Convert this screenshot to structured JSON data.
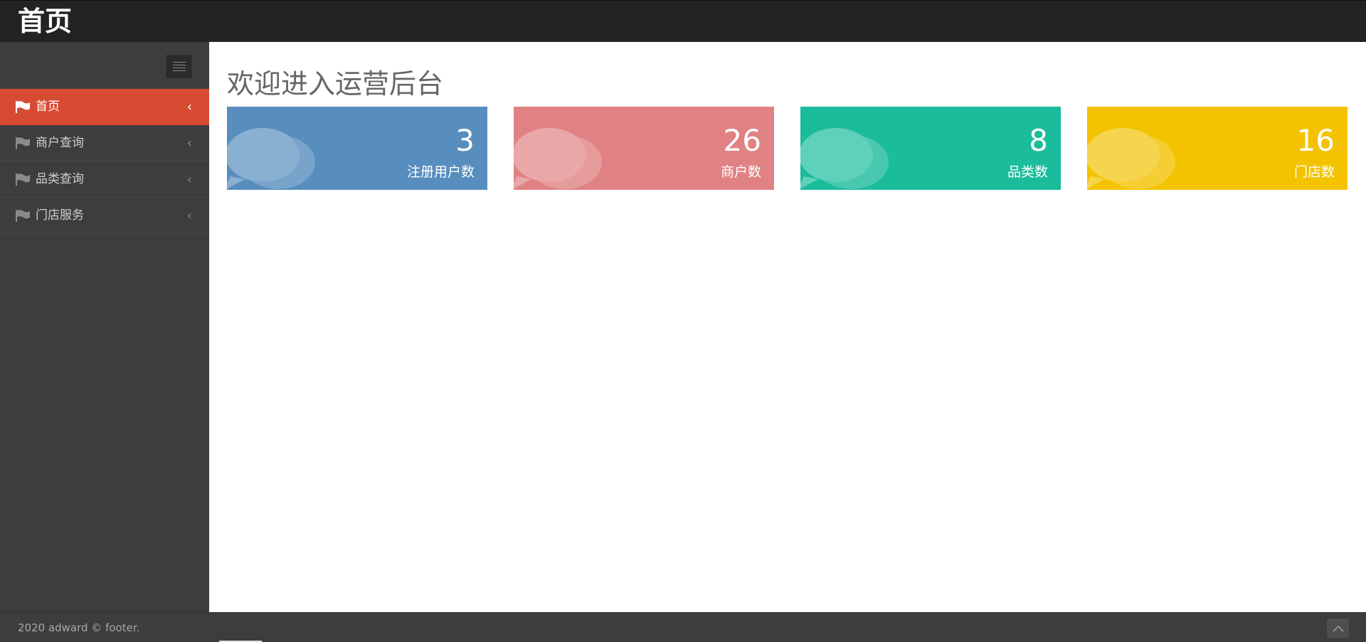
{
  "header": {
    "brand": "首页"
  },
  "sidebar": {
    "toggle_icon": "menu-icon",
    "items": [
      {
        "label": "首页",
        "icon": "flag-icon",
        "chevron": "‹",
        "active": true
      },
      {
        "label": "商户查询",
        "icon": "flag-icon",
        "chevron": "‹",
        "active": false
      },
      {
        "label": "品类查询",
        "icon": "flag-icon",
        "chevron": "‹",
        "active": false
      },
      {
        "label": "门店服务",
        "icon": "flag-icon",
        "chevron": "‹",
        "active": false
      }
    ]
  },
  "main": {
    "title": "欢迎进入运营后台",
    "cards": [
      {
        "value": "3",
        "label": "注册用户数",
        "color": "#578ebe",
        "icon": "comments-icon"
      },
      {
        "value": "26",
        "label": "商户数",
        "color": "#e08283",
        "icon": "comments-icon"
      },
      {
        "value": "8",
        "label": "品类数",
        "color": "#1bbc9b",
        "icon": "comments-icon"
      },
      {
        "value": "16",
        "label": "门店数",
        "color": "#f3c200",
        "icon": "comments-icon"
      }
    ]
  },
  "footer": {
    "text": "2020 adward © footer.",
    "go_top_icon": "chevron-up-icon"
  },
  "colors": {
    "topbar": "#232323",
    "sidebar": "#3d3d3d",
    "active_menu": "#d84b33"
  }
}
